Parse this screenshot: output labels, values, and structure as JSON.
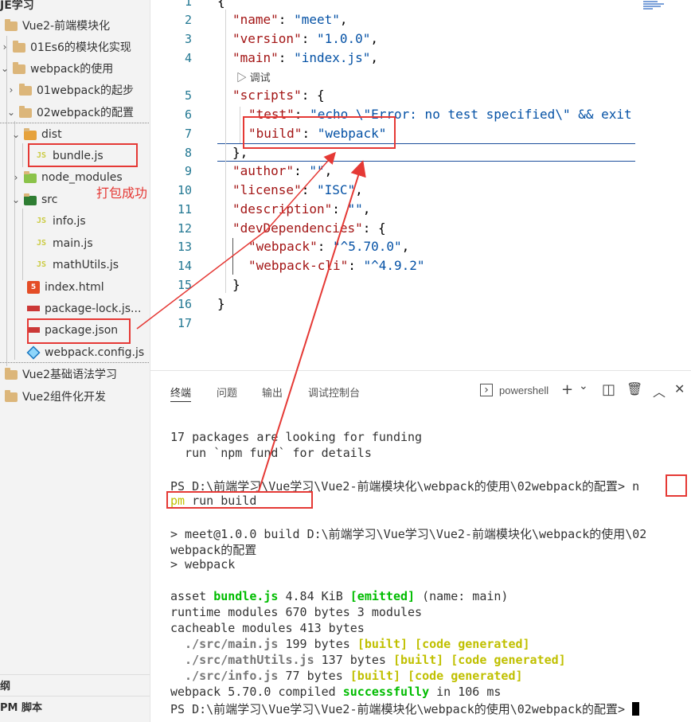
{
  "explorer": {
    "items": [
      {
        "label": "JE学习",
        "depth": 0
      },
      {
        "label": "Vue2-前端模块化",
        "depth": 0
      },
      {
        "label": "01Es6的模块化实现",
        "depth": 1
      },
      {
        "label": "webpack的使用",
        "depth": 1
      },
      {
        "label": "01webpack的起步",
        "depth": 2
      },
      {
        "label": "02webpack的配置",
        "depth": 2
      },
      {
        "label": "dist",
        "depth": 3
      },
      {
        "label": "bundle.js",
        "depth": 4
      },
      {
        "label": "node_modules",
        "depth": 3
      },
      {
        "label": "src",
        "depth": 3
      },
      {
        "label": "info.js",
        "depth": 4
      },
      {
        "label": "main.js",
        "depth": 4
      },
      {
        "label": "mathUtils.js",
        "depth": 4
      },
      {
        "label": "index.html",
        "depth": 3
      },
      {
        "label": "package-lock.js...",
        "depth": 3
      },
      {
        "label": "package.json",
        "depth": 3
      },
      {
        "label": "webpack.config.js",
        "depth": 3
      },
      {
        "label": "Vue2基础语法学习",
        "depth": 0
      },
      {
        "label": "Vue2组件化开发",
        "depth": 0
      }
    ],
    "js_badge": "JS",
    "html_badge": "5",
    "outline_label": "纲",
    "npm_scripts_label": "PM 脚本"
  },
  "editor": {
    "line_numbers": [
      "1",
      "2",
      "3",
      "4",
      "5",
      "6",
      "7",
      "8",
      "9",
      "10",
      "11",
      "12",
      "13",
      "14",
      "15",
      "16",
      "17"
    ],
    "codelens": "▷ 调试",
    "lines": {
      "l1": "{",
      "l2k": "\"name\"",
      "l2v": "\"meet\"",
      "l3k": "\"version\"",
      "l3v": "\"1.0.0\"",
      "l4k": "\"main\"",
      "l4v": "\"index.js\"",
      "l5k": "\"scripts\"",
      "l5v": "{",
      "l6k": "\"test\"",
      "l6v": "\"echo \\\"Error: no test specified\\\" && exit",
      "l7k": "\"build\"",
      "l7v": "\"webpack\"",
      "l8": "},",
      "l9k": "\"author\"",
      "l9v": "\"\"",
      "l10k": "\"license\"",
      "l10v": "\"ISC\"",
      "l11k": "\"description\"",
      "l11v": "\"\"",
      "l12k": "\"devDependencies\"",
      "l12v": "{",
      "l13k": "\"webpack\"",
      "l13v": "\"^5.70.0\"",
      "l14k": "\"webpack-cli\"",
      "l14v": "\"^4.9.2\"",
      "l15": "}",
      "l16": "}"
    }
  },
  "panel": {
    "tabs": [
      "终端",
      "问题",
      "输出",
      "调试控制台"
    ],
    "shell": "powershell",
    "actions": {
      "add": "+",
      "dropdown": "⌄",
      "split": "◫",
      "trash": "🗑",
      "maximize": "︿",
      "close": "✕"
    }
  },
  "terminal": {
    "l1": "17 packages are looking for funding",
    "l2": "  run `npm fund` for details",
    "l3": "PS D:\\前端学习\\Vue学习\\Vue2-前端模块化\\webpack的使用\\02webpack的配置> ",
    "l3n": "n",
    "l4a": "pm",
    "l4b": " run build",
    "l5": "> meet@1.0.0 build D:\\前端学习\\Vue学习\\Vue2-前端模块化\\webpack的使用\\02",
    "l6": "webpack的配置",
    "l7": "> webpack",
    "l8a": "asset ",
    "l8b": "bundle.js",
    "l8c": " 4.84 KiB ",
    "l8d": "[emitted]",
    "l8e": " (name: main)",
    "l9": "runtime modules 670 bytes 3 modules",
    "l10": "cacheable modules 413 bytes",
    "l11a": "  ./src/main.js",
    "l11b": " 199 bytes ",
    "l11c": "[built] [code generated]",
    "l12a": "  ./src/mathUtils.js",
    "l12b": " 137 bytes ",
    "l12c": "[built] [code generated]",
    "l13a": "  ./src/info.js",
    "l13b": " 77 bytes ",
    "l13c": "[built] [code generated]",
    "l14a": "webpack 5.70.0 compiled ",
    "l14b": "successfully",
    "l14c": " in 106 ms",
    "l15": "PS D:\\前端学习\\Vue学习\\Vue2-前端模块化\\webpack的使用\\02webpack的配置> "
  },
  "annotation": {
    "label": "打包成功",
    "color": "#e53935"
  }
}
